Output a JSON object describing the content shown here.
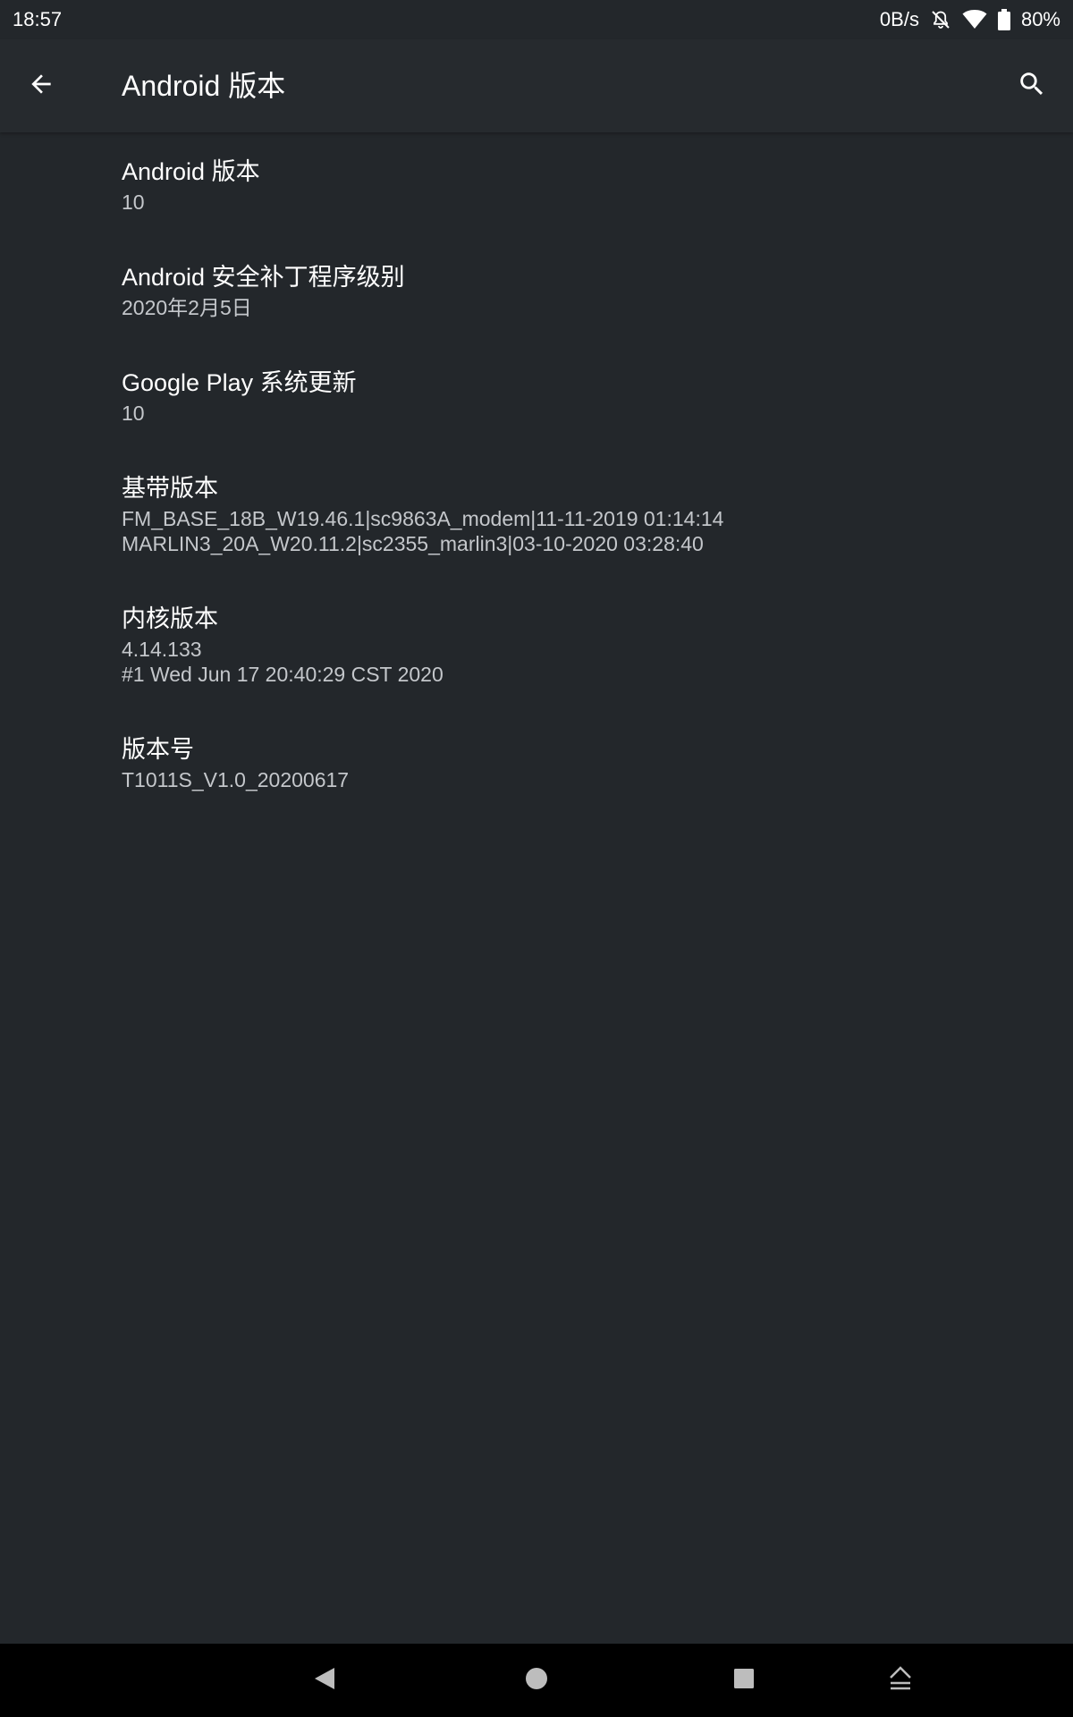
{
  "status_bar": {
    "time": "18:57",
    "net_speed": "0B/s",
    "battery": "80%"
  },
  "app_bar": {
    "title": "Android 版本"
  },
  "items": [
    {
      "title": "Android 版本",
      "summary": "10"
    },
    {
      "title": "Android 安全补丁程序级别",
      "summary": "2020年2月5日"
    },
    {
      "title": "Google Play 系统更新",
      "summary": "10"
    },
    {
      "title": "基带版本",
      "summary": "FM_BASE_18B_W19.46.1|sc9863A_modem|11-11-2019 01:14:14\nMARLIN3_20A_W20.11.2|sc2355_marlin3|03-10-2020 03:28:40"
    },
    {
      "title": "内核版本",
      "summary": "4.14.133\n#1 Wed Jun 17 20:40:29 CST 2020"
    },
    {
      "title": "版本号",
      "summary": "T1011S_V1.0_20200617"
    }
  ],
  "icons": {
    "back": "arrow-back-icon",
    "search": "search-icon",
    "notifications_off": "bell-off-icon",
    "wifi": "wifi-icon",
    "battery": "battery-icon",
    "nav_back": "triangle-back-icon",
    "nav_home": "circle-home-icon",
    "nav_recents": "square-recents-icon",
    "nav_eject": "eject-icon"
  },
  "colors": {
    "background": "#23272b",
    "app_bar": "#262a2e",
    "primary_text": "#ffffff",
    "secondary_text": "#c4c7cb",
    "nav_bar": "#000000"
  }
}
